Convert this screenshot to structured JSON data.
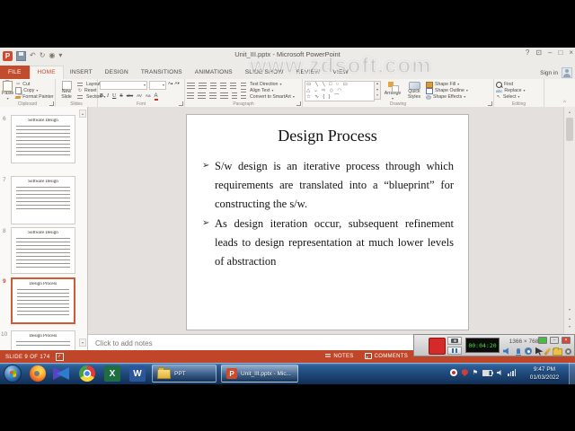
{
  "colors": {
    "accent": "#c0462a",
    "taskbar_blue": "#1d4676",
    "record_red": "#d42a2a",
    "lcd_green": "#46df3f"
  },
  "watermark": {
    "text": "www.zdsoft.com"
  },
  "window": {
    "title": "Unit_III.pptx - Microsoft PowerPoint",
    "sign_in": "Sign in"
  },
  "icons": {
    "app_letter": "P",
    "undo": "↶",
    "redo": "↻",
    "present": "◉",
    "more": "▾",
    "help": "?",
    "ribbon_display": "⊡",
    "minimize": "–",
    "maximize": "□",
    "close": "×",
    "dropdown": "▾",
    "up_arrow": "▲",
    "down_arrow": "▼",
    "collapse": "^",
    "cut": "✂",
    "check": "✓",
    "flag": "⚑",
    "select_arrow": "↖",
    "bold": "B",
    "italic": "I",
    "underline": "U",
    "strike": "S",
    "abc": "abc",
    "char_spacing": "AV",
    "change_case": "Aa",
    "font_color": "A",
    "grow_font": "A▴",
    "shrink_font": "A▾",
    "excel_letter": "X",
    "word_letter": "W",
    "bullet_marker": "➢",
    "shapes_row1": "▭ ╲ ╲ □ ○ ▭",
    "shapes_row2": "△ ⌣ ⇨ ◇ ◠",
    "shapes_row3": "☆ ∿ { } ⌒"
  },
  "ribbon": {
    "tabs": [
      {
        "label": "FILE"
      },
      {
        "label": "HOME"
      },
      {
        "label": "INSERT"
      },
      {
        "label": "DESIGN"
      },
      {
        "label": "TRANSITIONS"
      },
      {
        "label": "ANIMATIONS"
      },
      {
        "label": "SLIDE SHOW"
      },
      {
        "label": "REVIEW"
      },
      {
        "label": "VIEW"
      }
    ],
    "clipboard": {
      "label": "Clipboard",
      "paste": "Paste",
      "cut": "Cut",
      "copy": "Copy",
      "format_painter": "Format Painter"
    },
    "slides": {
      "label": "Slides",
      "new_slide": "New Slide",
      "layout": "Layout",
      "reset": "Reset",
      "section": "Section"
    },
    "font": {
      "label": "Font"
    },
    "paragraph": {
      "label": "Paragraph",
      "text_direction": "Text Direction",
      "align_text": "Align Text",
      "smartart": "Convert to SmartArt"
    },
    "drawing": {
      "label": "Drawing",
      "arrange": "Arrange",
      "quick_styles": "Quick Styles",
      "shape_fill": "Shape Fill",
      "shape_outline": "Shape Outline",
      "shape_effects": "Shape Effects"
    },
    "editing": {
      "label": "Editing",
      "find": "Find",
      "replace": "Replace",
      "select": "Select"
    }
  },
  "thumbnails": [
    {
      "number": "6",
      "title": "Software Design"
    },
    {
      "number": "7",
      "title": "Software Design"
    },
    {
      "number": "8",
      "title": "Software Design"
    },
    {
      "number": "9",
      "title": "Design Process"
    },
    {
      "number": "10",
      "title": "Design Process"
    }
  ],
  "slide": {
    "title": "Design Process",
    "bullets": [
      "S/w design is an iterative process through which requirements are translated into a “blueprint” for constructing the s/w.",
      "As design iteration occur, subsequent refinement leads to design representation at much lower levels of abstraction"
    ]
  },
  "notes": {
    "placeholder": "Click to add notes"
  },
  "status": {
    "slide_indicator": "SLIDE 9 OF 174",
    "notes": "NOTES",
    "comments": "COMMENTS"
  },
  "recorder": {
    "timer": "00:04:20",
    "resolution": "1366 × 768"
  },
  "taskbar": {
    "folder_label": "PPT",
    "window_label": "Unit_III.pptx - Mic...",
    "time": "9:47 PM",
    "date": "01/03/2022"
  }
}
